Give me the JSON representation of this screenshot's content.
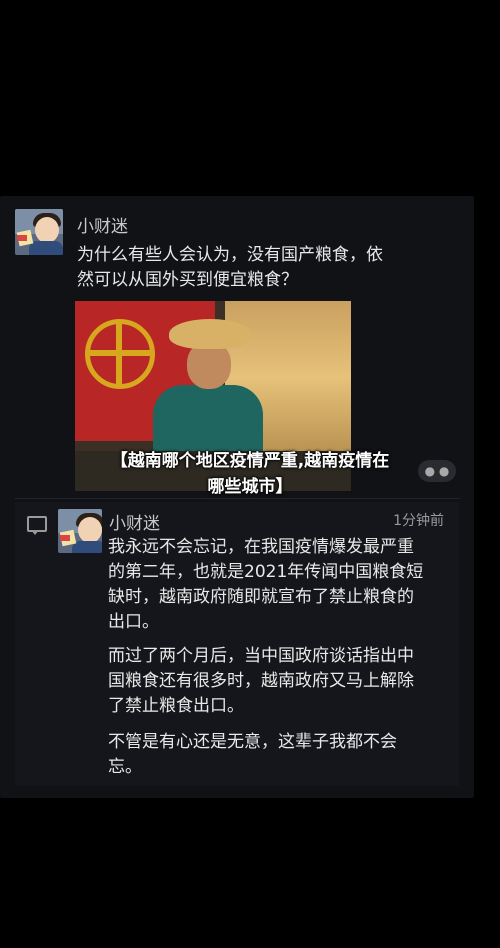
{
  "post": {
    "author": "小财迷",
    "text": "为什么有些人会认为，没有国产粮食，依\n然可以从国外买到便宜粮食？"
  },
  "overlay": {
    "title": "【越南哪个地区疫情严重,越南疫情在\n哪些城市】"
  },
  "reply": {
    "author": "小财迷",
    "time": "1分钟前",
    "paragraph_1": "我永远不会忘记，在我国疫情爆发最严重\n的第二年，也就是2021年传闻中国粮食短\n缺时，越南政府随即就宣布了禁止粮食的\n出口。",
    "paragraph_2": "而过了两个月后，当中国政府谈话指出中\n国粮食还有很多时，越南政府又马上解除\n了禁止粮食出口。",
    "paragraph_3": "不管是有心还是无意，这辈子我都不会\n忘。"
  },
  "icons": {
    "more": "more-icon",
    "comment": "comment-icon"
  }
}
